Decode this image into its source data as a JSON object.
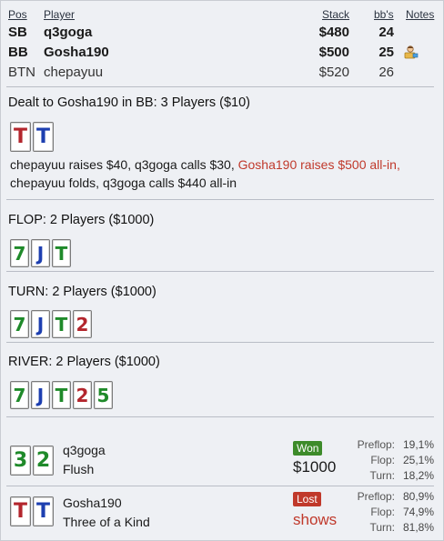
{
  "header": {
    "pos": "Pos",
    "player": "Player",
    "stack": "Stack",
    "bbs": "bb's",
    "notes": "Notes"
  },
  "players": [
    {
      "pos": "SB",
      "name": "q3goga",
      "stack": "$480",
      "bbs": "24"
    },
    {
      "pos": "BB",
      "name": "Gosha190",
      "stack": "$500",
      "bbs": "25"
    },
    {
      "pos": "BTN",
      "name": "chepayuu",
      "stack": "$520",
      "bbs": "26"
    }
  ],
  "notes_icon": "user-note-icon",
  "preflop": {
    "title": "Dealt to Gosha190 in BB: 3 Players ($10)",
    "cards": [
      {
        "rank": "T",
        "suit": "hearts"
      },
      {
        "rank": "T",
        "suit": "diamonds"
      }
    ],
    "action_1": "chepayuu raises $40, q3goga calls $30, ",
    "action_hl": "Gosha190 raises $500 all-in,",
    "action_2": "chepayuu folds, q3goga calls $440 all-in"
  },
  "flop": {
    "title": "FLOP: 2 Players ($1000)",
    "cards": [
      {
        "rank": "7",
        "suit": "clubs"
      },
      {
        "rank": "J",
        "suit": "diamonds"
      },
      {
        "rank": "T",
        "suit": "clubs"
      }
    ]
  },
  "turn": {
    "title": "TURN: 2 Players ($1000)",
    "cards": [
      {
        "rank": "7",
        "suit": "clubs"
      },
      {
        "rank": "J",
        "suit": "diamonds"
      },
      {
        "rank": "T",
        "suit": "clubs"
      },
      {
        "rank": "2",
        "suit": "hearts"
      }
    ]
  },
  "river": {
    "title": "RIVER: 2 Players ($1000)",
    "cards": [
      {
        "rank": "7",
        "suit": "clubs"
      },
      {
        "rank": "J",
        "suit": "diamonds"
      },
      {
        "rank": "T",
        "suit": "clubs"
      },
      {
        "rank": "2",
        "suit": "hearts"
      },
      {
        "rank": "5",
        "suit": "clubs"
      }
    ]
  },
  "results": [
    {
      "name": "q3goga",
      "hand": "Flush",
      "cards": [
        {
          "rank": "3",
          "suit": "clubs"
        },
        {
          "rank": "2",
          "suit": "clubs"
        }
      ],
      "status": "Won",
      "status_color": "#3d8b2a",
      "amount": "$1000",
      "preflop_label": "Preflop:",
      "preflop": "19,1%",
      "flop_label": "Flop:",
      "flop": "25,1%",
      "turn_label": "Turn:",
      "turn": "18,2%"
    },
    {
      "name": "Gosha190",
      "hand": "Three of a Kind",
      "cards": [
        {
          "rank": "T",
          "suit": "hearts"
        },
        {
          "rank": "T",
          "suit": "diamonds"
        }
      ],
      "status": "Lost",
      "status_color": "#c0392b",
      "amount": "shows",
      "preflop_label": "Preflop:",
      "preflop": "80,9%",
      "flop_label": "Flop:",
      "flop": "74,9%",
      "turn_label": "Turn:",
      "turn": "81,8%"
    }
  ],
  "colors": {
    "hearts": "#b3262d",
    "diamonds": "#1d3fb0",
    "clubs": "#1f8a2a",
    "spades": "#1a1a1a"
  }
}
